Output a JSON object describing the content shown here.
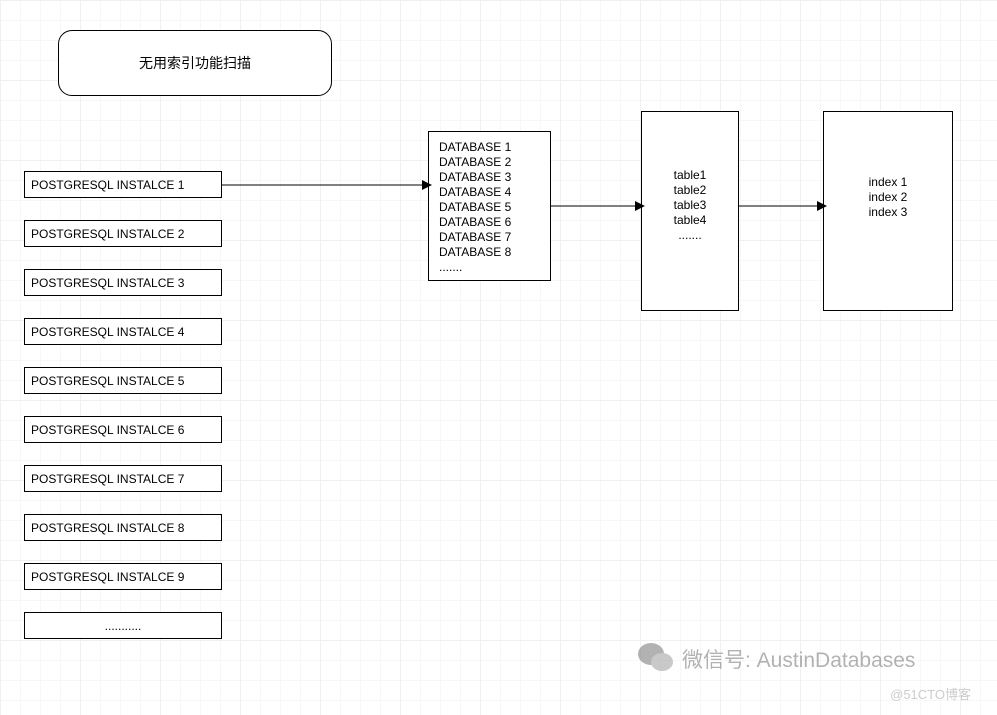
{
  "title": "无用索引功能扫描",
  "instances": [
    "POSTGRESQL  INSTALCE 1",
    "POSTGRESQL  INSTALCE 2",
    "POSTGRESQL  INSTALCE 3",
    "POSTGRESQL  INSTALCE 4",
    "POSTGRESQL  INSTALCE 5",
    "POSTGRESQL  INSTALCE 6",
    "POSTGRESQL  INSTALCE 7",
    "POSTGRESQL  INSTALCE 8",
    "POSTGRESQL  INSTALCE 9"
  ],
  "instances_more": "...........",
  "databases": [
    "DATABASE 1",
    "DATABASE 2",
    "DATABASE 3",
    "DATABASE 4",
    "DATABASE 5",
    "DATABASE 6",
    "DATABASE 7",
    "DATABASE 8"
  ],
  "databases_more": ".......",
  "tables": [
    "table1",
    "table2",
    "table3",
    "table4"
  ],
  "tables_more": ".......",
  "indexes": [
    "index 1",
    "index 2",
    "index 3"
  ],
  "wechat_label": "微信号: AustinDatabases",
  "watermark": "@51CTO博客"
}
